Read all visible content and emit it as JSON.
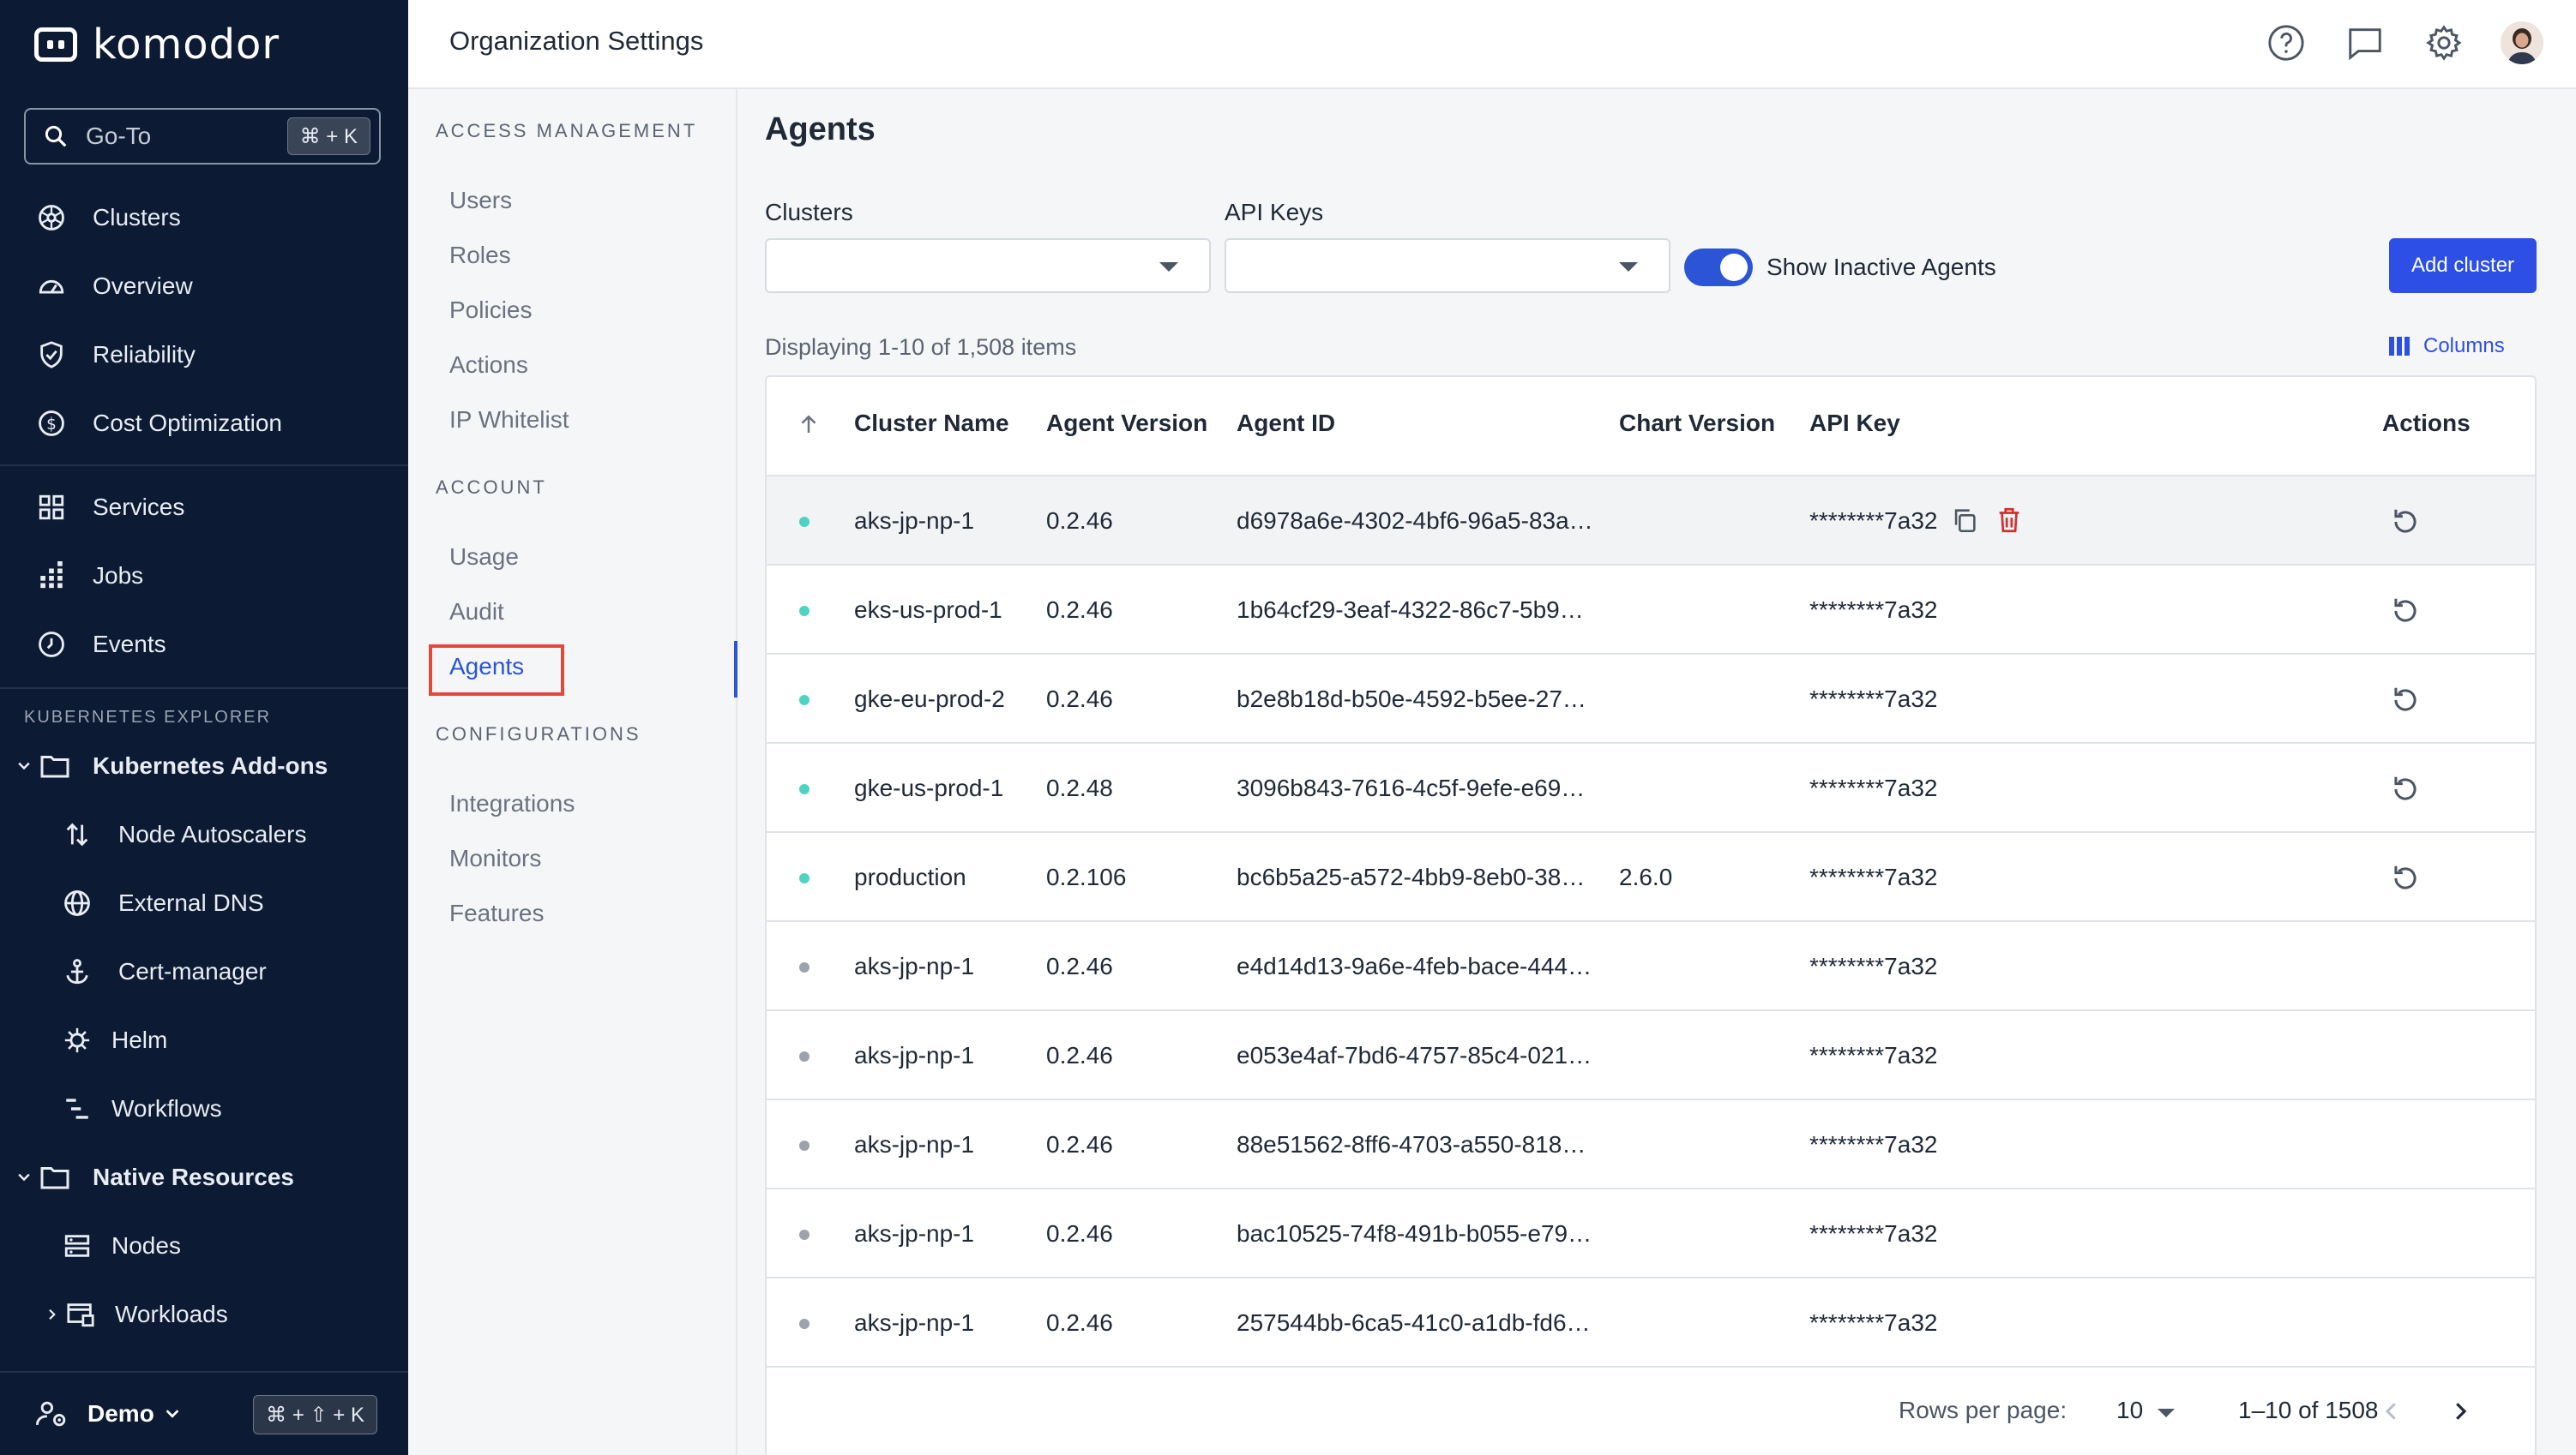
{
  "sidebar": {
    "logo": "komodor",
    "goto": {
      "label": "Go-To",
      "shortcut": "⌘ + K"
    },
    "primary": [
      {
        "label": "Clusters",
        "icon": "clusters-icon"
      },
      {
        "label": "Overview",
        "icon": "gauge-icon"
      },
      {
        "label": "Reliability",
        "icon": "shield-check-icon"
      },
      {
        "label": "Cost Optimization",
        "icon": "dollar-icon"
      }
    ],
    "secondary": [
      {
        "label": "Services",
        "icon": "grid-icon"
      },
      {
        "label": "Jobs",
        "icon": "dots-grid-icon"
      },
      {
        "label": "Events",
        "icon": "clock-icon"
      }
    ],
    "k8s_section": "KUBERNETES EXPLORER",
    "addons": {
      "label": "Kubernetes Add-ons",
      "items": [
        {
          "label": "Node Autoscalers",
          "icon": "autoscale-icon"
        },
        {
          "label": "External DNS",
          "icon": "globe-icon"
        },
        {
          "label": "Cert-manager",
          "icon": "anchor-icon"
        },
        {
          "label": "Helm",
          "icon": "helm-icon"
        },
        {
          "label": "Workflows",
          "icon": "workflow-icon"
        }
      ]
    },
    "native": {
      "label": "Native Resources",
      "items": [
        {
          "label": "Nodes",
          "icon": "server-icon"
        },
        {
          "label": "Workloads",
          "icon": "workloads-icon"
        }
      ]
    },
    "account": {
      "label": "Demo",
      "shortcut": "⌘ + ⇧ + K"
    }
  },
  "header": {
    "title": "Organization Settings"
  },
  "settings_nav": {
    "access_title": "ACCESS MANAGEMENT",
    "access": [
      "Users",
      "Roles",
      "Policies",
      "Actions",
      "IP Whitelist"
    ],
    "account_title": "ACCOUNT",
    "account": [
      "Usage",
      "Audit",
      "Agents"
    ],
    "config_title": "CONFIGURATIONS",
    "config": [
      "Integrations",
      "Monitors",
      "Features"
    ]
  },
  "main": {
    "title": "Agents",
    "clusters_label": "Clusters",
    "apikeys_label": "API Keys",
    "toggle_label": "Show Inactive Agents",
    "add_button": "Add cluster",
    "displaying": "Displaying 1-10 of 1,508 items",
    "columns_button": "Columns",
    "headers": [
      "Cluster Name",
      "Agent Version",
      "Agent ID",
      "Chart Version",
      "API Key",
      "Actions"
    ],
    "rows": [
      {
        "status": "active",
        "cluster": "aks-jp-np-1",
        "version": "0.2.46",
        "agent_id": "d6978a6e-4302-4bf6-96a5-83a…",
        "chart": "",
        "api_key": "********7a32",
        "restart": true
      },
      {
        "status": "active",
        "cluster": "eks-us-prod-1",
        "version": "0.2.46",
        "agent_id": "1b64cf29-3eaf-4322-86c7-5b9…",
        "chart": "",
        "api_key": "********7a32",
        "restart": true
      },
      {
        "status": "active",
        "cluster": "gke-eu-prod-2",
        "version": "0.2.46",
        "agent_id": "b2e8b18d-b50e-4592-b5ee-27…",
        "chart": "",
        "api_key": "********7a32",
        "restart": true
      },
      {
        "status": "active",
        "cluster": "gke-us-prod-1",
        "version": "0.2.48",
        "agent_id": "3096b843-7616-4c5f-9efe-e69…",
        "chart": "",
        "api_key": "********7a32",
        "restart": true
      },
      {
        "status": "active",
        "cluster": "production",
        "version": "0.2.106",
        "agent_id": "bc6b5a25-a572-4bb9-8eb0-38…",
        "chart": "2.6.0",
        "api_key": "********7a32",
        "restart": true
      },
      {
        "status": "inactive",
        "cluster": "aks-jp-np-1",
        "version": "0.2.46",
        "agent_id": "e4d14d13-9a6e-4feb-bace-444…",
        "chart": "",
        "api_key": "********7a32",
        "restart": false
      },
      {
        "status": "inactive",
        "cluster": "aks-jp-np-1",
        "version": "0.2.46",
        "agent_id": "e053e4af-7bd6-4757-85c4-021…",
        "chart": "",
        "api_key": "********7a32",
        "restart": false
      },
      {
        "status": "inactive",
        "cluster": "aks-jp-np-1",
        "version": "0.2.46",
        "agent_id": "88e51562-8ff6-4703-a550-818…",
        "chart": "",
        "api_key": "********7a32",
        "restart": false
      },
      {
        "status": "inactive",
        "cluster": "aks-jp-np-1",
        "version": "0.2.46",
        "agent_id": "bac10525-74f8-491b-b055-e79…",
        "chart": "",
        "api_key": "********7a32",
        "restart": false
      },
      {
        "status": "inactive",
        "cluster": "aks-jp-np-1",
        "version": "0.2.46",
        "agent_id": "257544bb-6ca5-41c0-a1db-fd6…",
        "chart": "",
        "api_key": "********7a32",
        "restart": false
      }
    ],
    "pagination": {
      "rows_label": "Rows per page:",
      "rows_value": "10",
      "range": "1–10 of 1508"
    }
  },
  "colors": {
    "sidebar_bg": "#0c1a33",
    "accent": "#2d4fe6",
    "active_dot": "#4cd3c2",
    "delete": "#d32f2f"
  }
}
